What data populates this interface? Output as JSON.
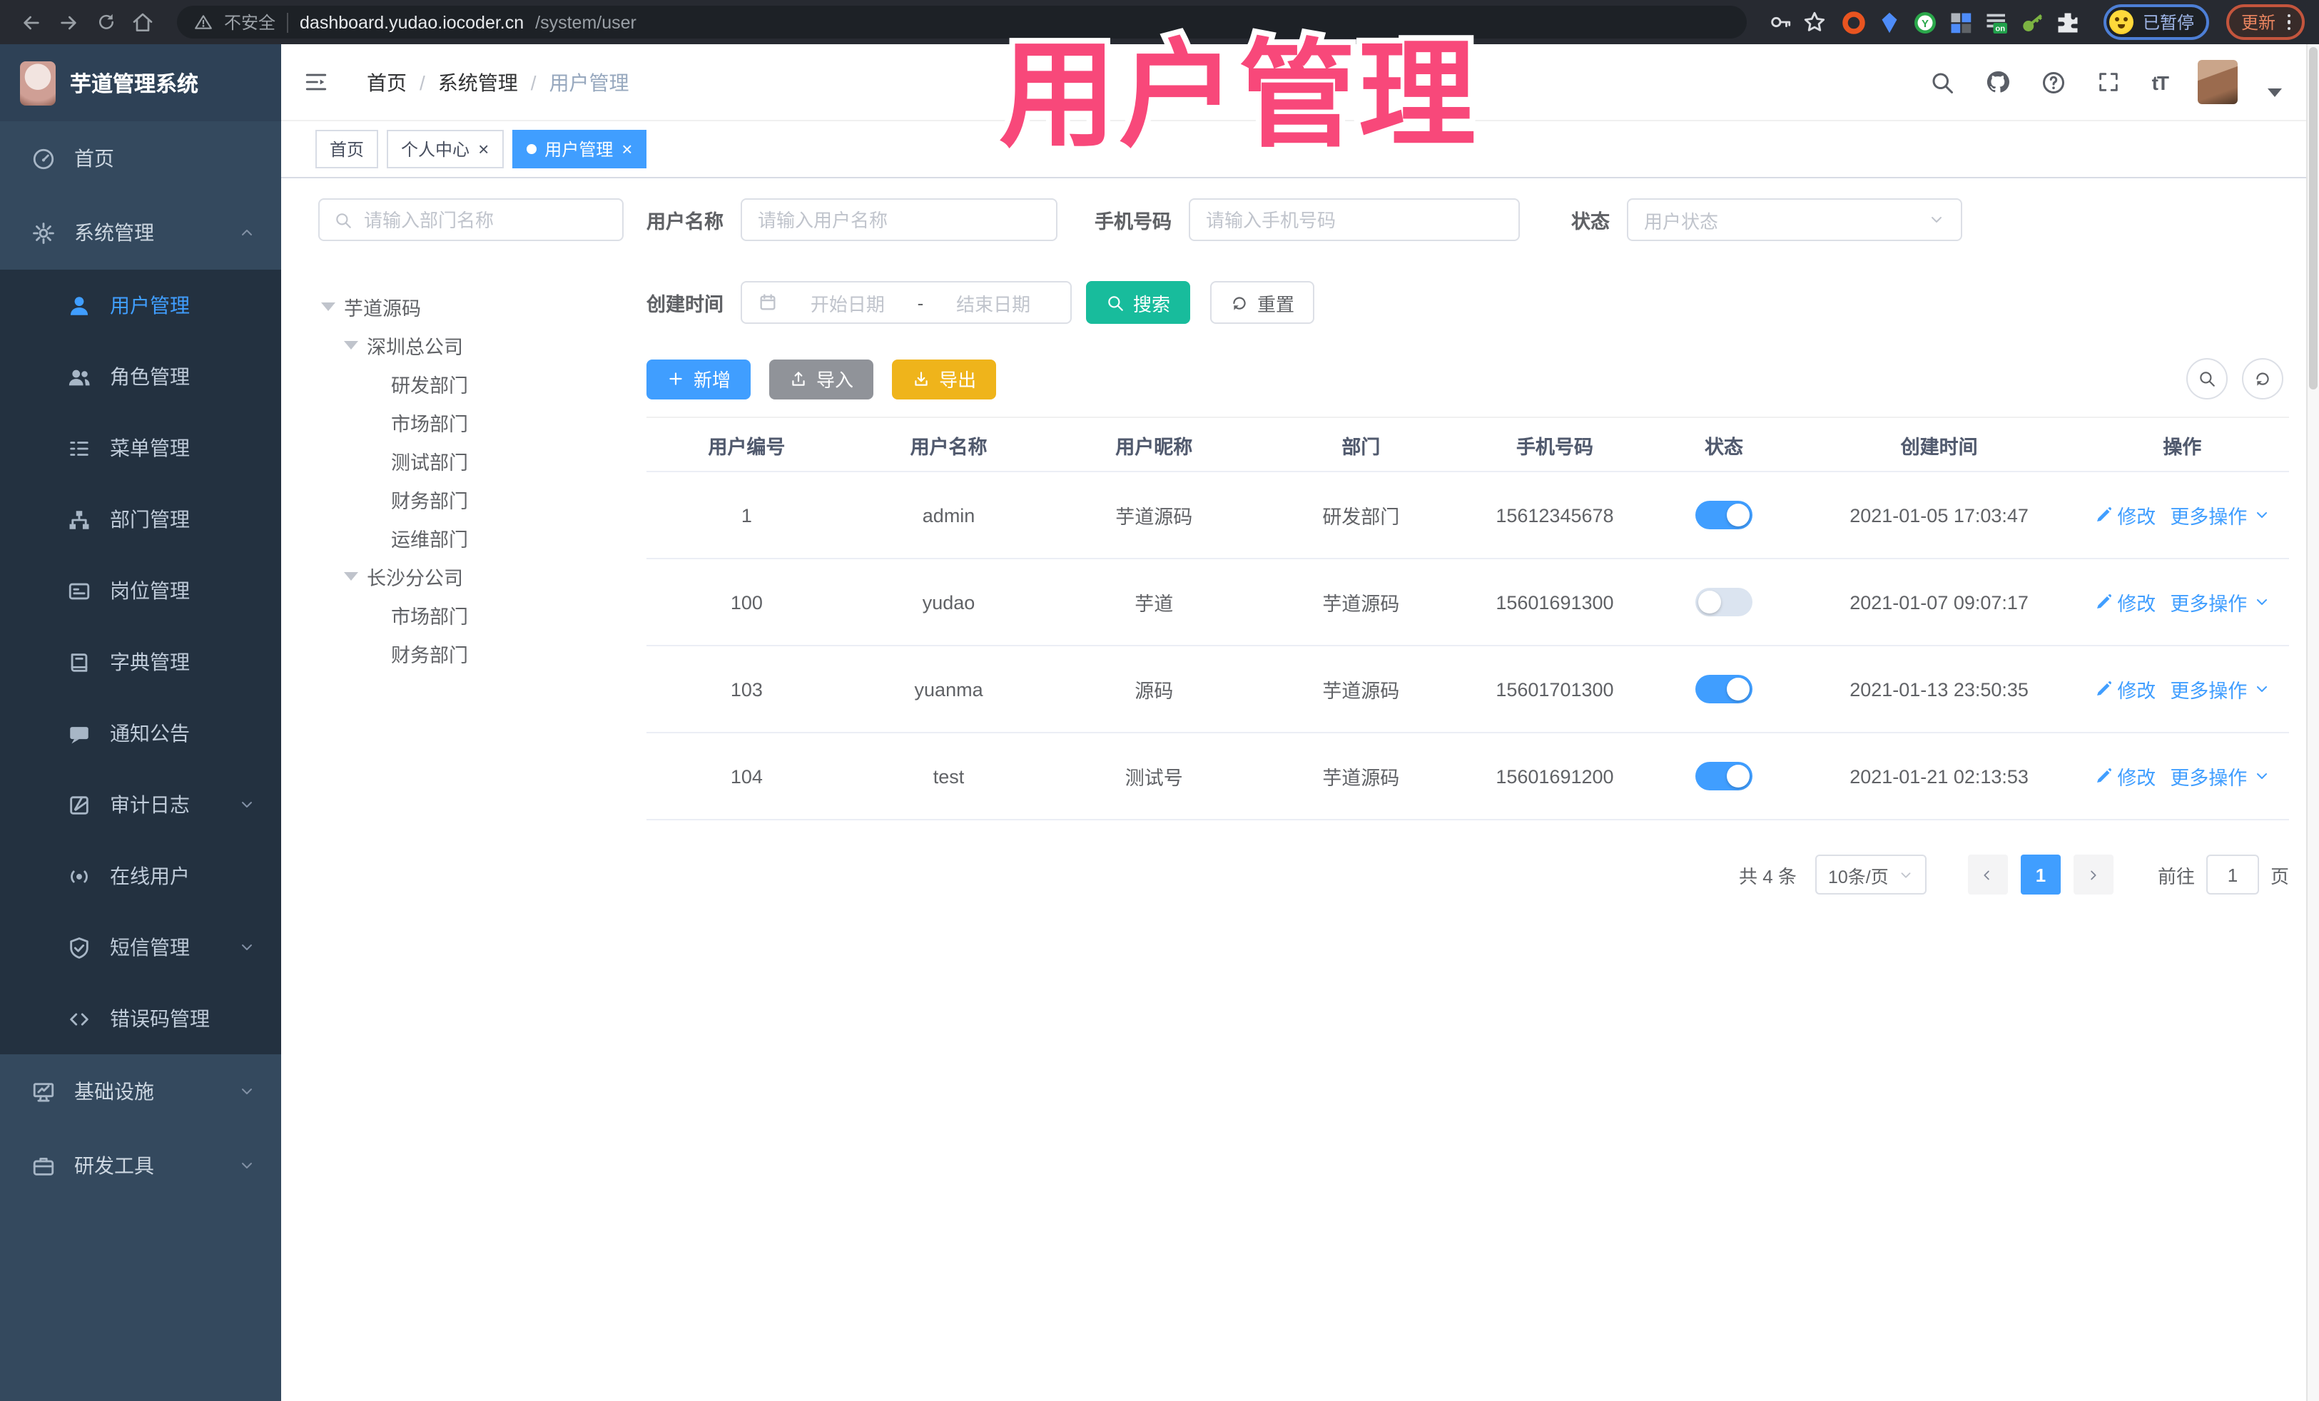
{
  "browser": {
    "security_label": "不安全",
    "url_host": "dashboard.yudao.iocoder.cn",
    "url_path": "/system/user",
    "profile_status": "已暂停",
    "update_label": "更新",
    "extensions": [
      {
        "name": "orange-ring-extension-icon"
      },
      {
        "name": "blue-gem-extension-icon"
      },
      {
        "name": "green-y-extension-icon"
      },
      {
        "name": "grid-extension-icon"
      },
      {
        "name": "list-on-extension-icon"
      },
      {
        "name": "green-key-extension-icon"
      },
      {
        "name": "puzzle-extension-icon"
      }
    ]
  },
  "overlay": {
    "title": "用户管理",
    "color": "#F8487A"
  },
  "app": {
    "logo_title": "芋道管理系统",
    "breadcrumb": [
      "首页",
      "系统管理",
      "用户管理"
    ],
    "breadcrumb_separator": "/",
    "font_icon_text": "tT",
    "tabs": [
      {
        "label": "首页",
        "active": false,
        "closable": false,
        "dot": false
      },
      {
        "label": "个人中心",
        "active": false,
        "closable": true,
        "dot": false
      },
      {
        "label": "用户管理",
        "active": true,
        "closable": true,
        "dot": true
      }
    ]
  },
  "sidebar": {
    "items": [
      {
        "label": "首页",
        "icon": "dashboard-icon",
        "sub": false
      },
      {
        "label": "系统管理",
        "icon": "gear-icon",
        "sub": false,
        "chevron": "up"
      },
      {
        "label": "用户管理",
        "icon": "user-icon",
        "sub": true,
        "active": true
      },
      {
        "label": "角色管理",
        "icon": "users-icon",
        "sub": true
      },
      {
        "label": "菜单管理",
        "icon": "menu-tree-icon",
        "sub": true
      },
      {
        "label": "部门管理",
        "icon": "org-tree-icon",
        "sub": true
      },
      {
        "label": "岗位管理",
        "icon": "badge-icon",
        "sub": true
      },
      {
        "label": "字典管理",
        "icon": "dictionary-icon",
        "sub": true
      },
      {
        "label": "通知公告",
        "icon": "announcement-icon",
        "sub": true
      },
      {
        "label": "审计日志",
        "icon": "audit-log-icon",
        "sub": true,
        "chevron": "down"
      },
      {
        "label": "在线用户",
        "icon": "online-user-icon",
        "sub": true
      },
      {
        "label": "短信管理",
        "icon": "sms-icon",
        "sub": true,
        "chevron": "down"
      },
      {
        "label": "错误码管理",
        "icon": "error-code-icon",
        "sub": true
      },
      {
        "label": "基础设施",
        "icon": "infrastructure-icon",
        "sub": false,
        "chevron": "down"
      },
      {
        "label": "研发工具",
        "icon": "dev-tools-icon",
        "sub": false,
        "chevron": "down"
      }
    ]
  },
  "dept": {
    "search_placeholder": "请输入部门名称",
    "tree": [
      {
        "label": "芋道源码",
        "level": 0,
        "caret": true
      },
      {
        "label": "深圳总公司",
        "level": 1,
        "caret": true
      },
      {
        "label": "研发部门",
        "level": 2,
        "caret": false
      },
      {
        "label": "市场部门",
        "level": 2,
        "caret": false
      },
      {
        "label": "测试部门",
        "level": 2,
        "caret": false
      },
      {
        "label": "财务部门",
        "level": 2,
        "caret": false
      },
      {
        "label": "运维部门",
        "level": 2,
        "caret": false
      },
      {
        "label": "长沙分公司",
        "level": 1,
        "caret": true
      },
      {
        "label": "市场部门",
        "level": 2,
        "caret": false
      },
      {
        "label": "财务部门",
        "level": 2,
        "caret": false
      }
    ]
  },
  "filters": {
    "username_label": "用户名称",
    "username_placeholder": "请输入用户名称",
    "mobile_label": "手机号码",
    "mobile_placeholder": "请输入手机号码",
    "status_label": "状态",
    "status_placeholder": "用户状态",
    "created_label": "创建时间",
    "start_placeholder": "开始日期",
    "range_separator": "-",
    "end_placeholder": "结束日期",
    "search_label": "搜索",
    "reset_label": "重置"
  },
  "toolbar": {
    "add_label": "新增",
    "import_label": "导入",
    "export_label": "导出"
  },
  "table": {
    "columns": [
      "用户编号",
      "用户名称",
      "用户昵称",
      "部门",
      "手机号码",
      "状态",
      "创建时间",
      "操作"
    ],
    "ops": {
      "edit": "修改",
      "more": "更多操作"
    },
    "rows": [
      {
        "id": "1",
        "username": "admin",
        "nickname": "芋道源码",
        "dept": "研发部门",
        "mobile": "15612345678",
        "status": true,
        "created": "2021-01-05 17:03:47"
      },
      {
        "id": "100",
        "username": "yudao",
        "nickname": "芋道",
        "dept": "芋道源码",
        "mobile": "15601691300",
        "status": false,
        "created": "2021-01-07 09:07:17"
      },
      {
        "id": "103",
        "username": "yuanma",
        "nickname": "源码",
        "dept": "芋道源码",
        "mobile": "15601701300",
        "status": true,
        "created": "2021-01-13 23:50:35"
      },
      {
        "id": "104",
        "username": "test",
        "nickname": "测试号",
        "dept": "芋道源码",
        "mobile": "15601691200",
        "status": true,
        "created": "2021-01-21 02:13:53"
      }
    ]
  },
  "pagination": {
    "total_text": "共 4 条",
    "page_size": "10条/页",
    "current_page": "1",
    "goto_label": "前往",
    "goto_value": "1",
    "page_unit": "页"
  },
  "colors": {
    "accent": "#409EFF",
    "teal": "#18BC9C",
    "warning": "#EFB41B",
    "sidebar": "#34495E",
    "submenu": "#233140",
    "overlay_pink": "#F8487A"
  }
}
